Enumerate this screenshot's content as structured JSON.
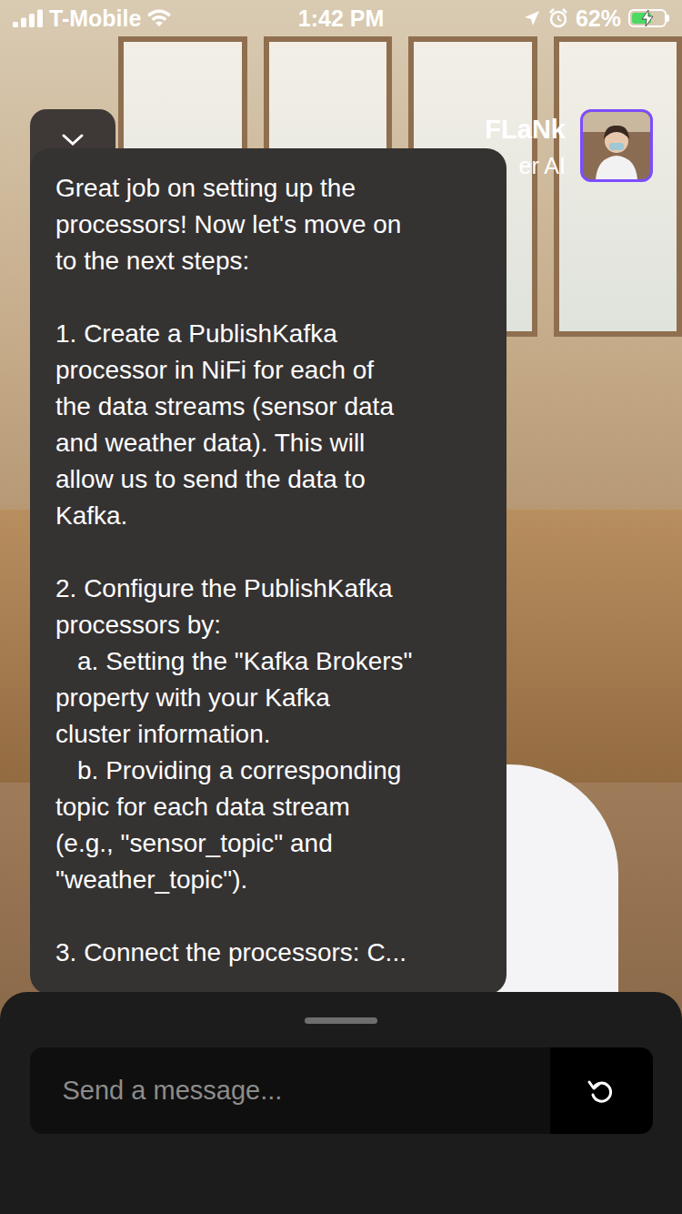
{
  "status_bar": {
    "carrier": "T-Mobile",
    "time": "1:42 PM",
    "battery": "62%",
    "battery_level": 0.62,
    "charging": true,
    "signal_bars": 4
  },
  "header": {
    "name": "FLaNk",
    "subtitle": "er AI"
  },
  "message": {
    "paragraphs": [
      {
        "lines": [
          {
            "text": "Great job on setting up the",
            "indent": false
          },
          {
            "text": "processors! Now let's move on",
            "indent": false
          },
          {
            "text": "to the next steps:",
            "indent": false
          }
        ]
      },
      {
        "lines": [
          {
            "text": "1. Create a PublishKafka",
            "indent": false
          },
          {
            "text": "processor in NiFi for each of",
            "indent": false
          },
          {
            "text": "the data streams (sensor data",
            "indent": false
          },
          {
            "text": "and weather data). This will",
            "indent": false
          },
          {
            "text": "allow us to send the data to",
            "indent": false
          },
          {
            "text": "Kafka.",
            "indent": false
          }
        ]
      },
      {
        "lines": [
          {
            "text": "2. Configure the PublishKafka",
            "indent": false
          },
          {
            "text": "processors by:",
            "indent": false
          },
          {
            "text": "a. Setting the \"Kafka Brokers\"",
            "indent": true
          },
          {
            "text": "property with your Kafka",
            "indent": false
          },
          {
            "text": "cluster information.",
            "indent": false
          },
          {
            "text": "b. Providing a corresponding",
            "indent": true
          },
          {
            "text": "topic for each data stream",
            "indent": false
          },
          {
            "text": "(e.g., \"sensor_topic\" and",
            "indent": false
          },
          {
            "text": "\"weather_topic\").",
            "indent": false
          }
        ]
      },
      {
        "lines": [
          {
            "text": "3. Connect the processors: C...",
            "indent": false
          }
        ]
      }
    ]
  },
  "composer": {
    "placeholder": "Send a message..."
  }
}
